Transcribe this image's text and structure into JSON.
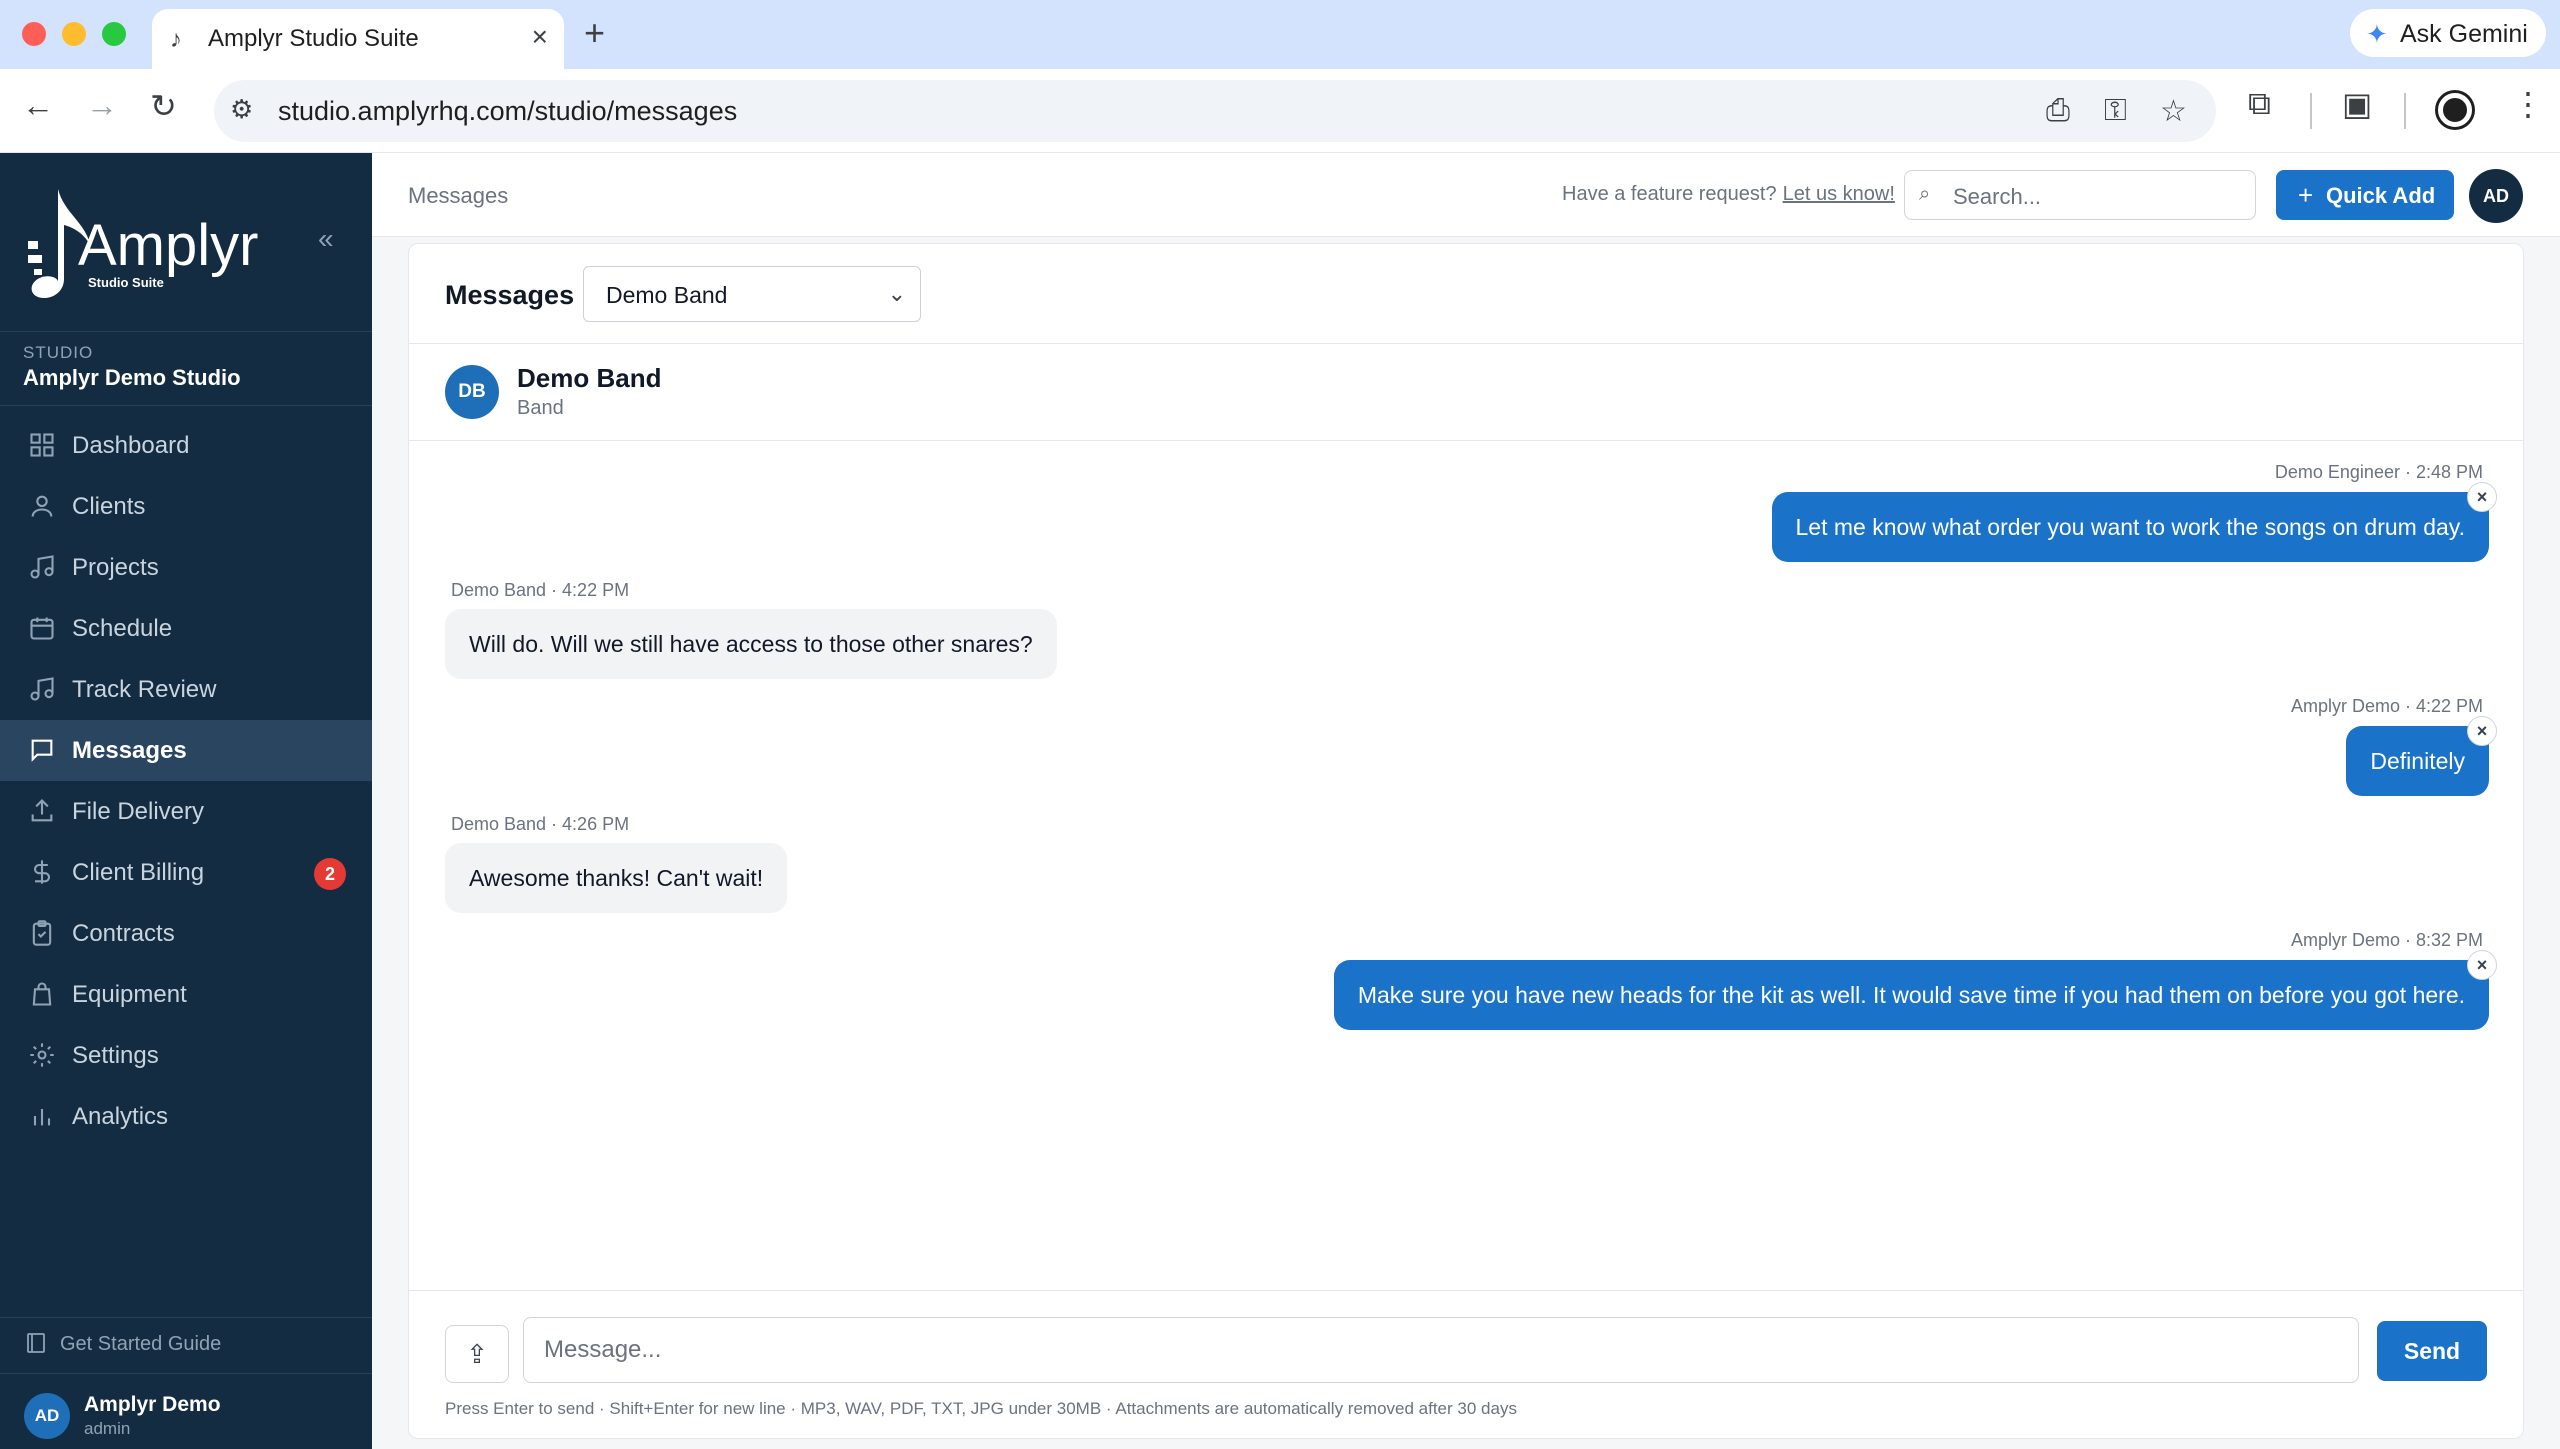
{
  "browser": {
    "tab_title": "Amplyr Studio Suite",
    "url": "studio.amplyrhq.com/studio/messages",
    "gemini_label": "Ask Gemini"
  },
  "sidebar": {
    "logo_text": "Amplyr",
    "logo_subtext": "Studio Suite",
    "studio_label": "STUDIO",
    "studio_name": "Amplyr Demo Studio",
    "items": [
      {
        "label": "Dashboard",
        "icon": "grid-icon"
      },
      {
        "label": "Clients",
        "icon": "user-icon"
      },
      {
        "label": "Projects",
        "icon": "music-note-icon"
      },
      {
        "label": "Schedule",
        "icon": "calendar-icon"
      },
      {
        "label": "Track Review",
        "icon": "music-note-icon"
      },
      {
        "label": "Messages",
        "icon": "chat-icon",
        "active": true
      },
      {
        "label": "File Delivery",
        "icon": "upload-icon"
      },
      {
        "label": "Client Billing",
        "icon": "dollar-icon",
        "badge": "2"
      },
      {
        "label": "Contracts",
        "icon": "clipboard-icon"
      },
      {
        "label": "Equipment",
        "icon": "bag-icon"
      },
      {
        "label": "Settings",
        "icon": "gear-icon"
      },
      {
        "label": "Analytics",
        "icon": "bar-chart-icon"
      }
    ],
    "guide_label": "Get Started Guide",
    "user": {
      "initials": "AD",
      "name": "Amplyr Demo",
      "role": "admin"
    }
  },
  "topbar": {
    "breadcrumb": "Messages",
    "feature_text": "Have a feature request?",
    "feature_link": "Let us know!",
    "search_placeholder": "Search...",
    "quick_add_label": "Quick Add",
    "avatar_initials": "AD"
  },
  "messages_panel": {
    "title": "Messages",
    "selected_conversation": "Demo Band",
    "conversation": {
      "initials": "DB",
      "name": "Demo Band",
      "type": "Band"
    },
    "thread": [
      {
        "direction": "out",
        "meta": "Demo Engineer · 2:48 PM",
        "text": "Let me know what order you want to work the songs on drum day."
      },
      {
        "direction": "in",
        "meta": "Demo Band · 4:22 PM",
        "text": "Will do. Will we still have access to those other snares?"
      },
      {
        "direction": "out",
        "meta": "Amplyr Demo · 4:22 PM",
        "text": "Definitely"
      },
      {
        "direction": "in",
        "meta": "Demo Band · 4:26 PM",
        "text": "Awesome thanks! Can't wait!"
      },
      {
        "direction": "out",
        "meta": "Amplyr Demo · 8:32 PM",
        "text": "Make sure you have new heads for the kit as well. It would save time if you had them on before you got here."
      }
    ],
    "composer": {
      "placeholder": "Message...",
      "send_label": "Send",
      "hint": "Press Enter to send · Shift+Enter for new line · MP3, WAV, PDF, TXT, JPG under 30MB · Attachments are automatically removed after 30 days"
    }
  },
  "colors": {
    "sidebar_bg": "#132c42",
    "accent": "#1a73c8",
    "badge": "#e53935"
  }
}
